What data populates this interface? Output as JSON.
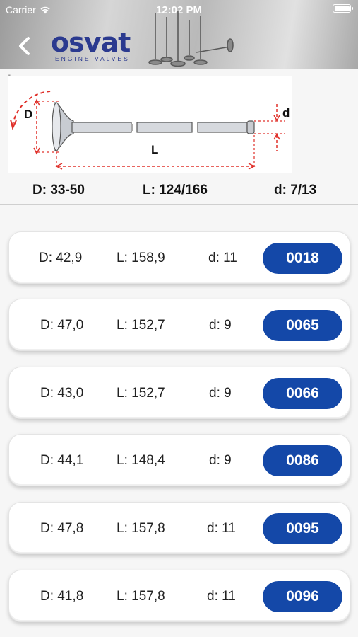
{
  "status_bar": {
    "carrier": "Carrier",
    "time": "12:02 PM"
  },
  "header": {
    "logo_text": "osvat",
    "logo_subtitle": "ENGINE VALVES"
  },
  "diagram": {
    "label_d_big": "D",
    "label_l": "L",
    "label_d_small": "d",
    "corner_mark": "\""
  },
  "specs": {
    "D": "D: 33-50",
    "L": "L: 124/166",
    "d": "d: 7/13"
  },
  "valves": [
    {
      "D": "D: 42,9",
      "L": "L: 158,9",
      "d": "d: 11",
      "code": "0018"
    },
    {
      "D": "D: 47,0",
      "L": "L: 152,7",
      "d": "d: 9",
      "code": "0065"
    },
    {
      "D": "D: 43,0",
      "L": "L: 152,7",
      "d": "d: 9",
      "code": "0066"
    },
    {
      "D": "D: 44,1",
      "L": "L: 148,4",
      "d": "d: 9",
      "code": "0086"
    },
    {
      "D": "D: 47,8",
      "L": "L: 157,8",
      "d": "d: 11",
      "code": "0095"
    },
    {
      "D": "D: 41,8",
      "L": "L: 157,8",
      "d": "d: 11",
      "code": "0096"
    }
  ],
  "colors": {
    "accent": "#1448a8",
    "logo": "#2b3a8f",
    "dimension_lines": "#e0302a"
  }
}
